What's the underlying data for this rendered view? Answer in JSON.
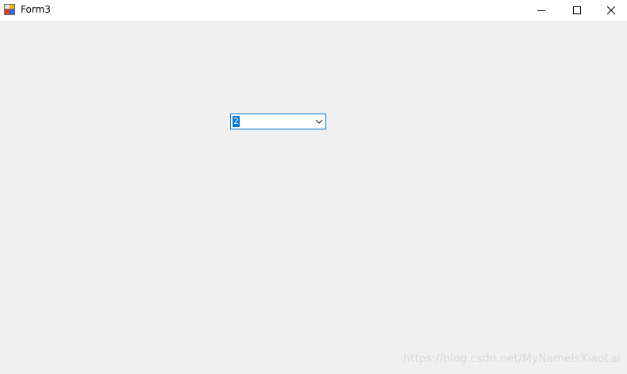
{
  "window": {
    "title": "Form3",
    "icons": {
      "app": "form-app-icon",
      "minimize": "minimize-icon",
      "maximize": "maximize-icon",
      "close": "close-icon"
    }
  },
  "combobox": {
    "value": "2",
    "arrow_icon": "chevron-down-icon",
    "accent_color": "#0078d7"
  },
  "watermark": {
    "text": "https://blog.csdn.net/MyNameIsXiaoLai"
  },
  "colors": {
    "client_background": "#f0f0f0",
    "titlebar_background": "#ffffff",
    "selection": "#0078d7"
  }
}
